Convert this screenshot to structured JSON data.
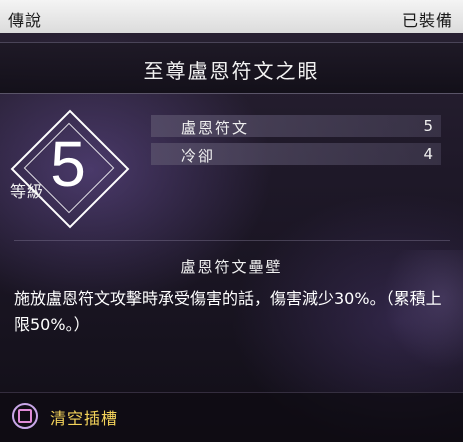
{
  "topbar": {
    "rarity": "傳說",
    "status": "已裝備"
  },
  "item": {
    "name": "至尊盧恩符文之眼"
  },
  "rank": {
    "value": "5",
    "label": "等級"
  },
  "stats": [
    {
      "label": "盧恩符文",
      "value": "5"
    },
    {
      "label": "冷卻",
      "value": "4"
    }
  ],
  "effect": {
    "name": "盧恩符文壘壁",
    "description": "施放盧恩符文攻擊時承受傷害的話，傷害減少30%。（累積上限50%。）"
  },
  "actions": {
    "clear_slot": "清空插槽",
    "button_icon": "square-button-icon"
  },
  "colors": {
    "action_label": "#f3d35a",
    "button_ring": "#c9a7e8",
    "button_square": "#e08bd7"
  }
}
